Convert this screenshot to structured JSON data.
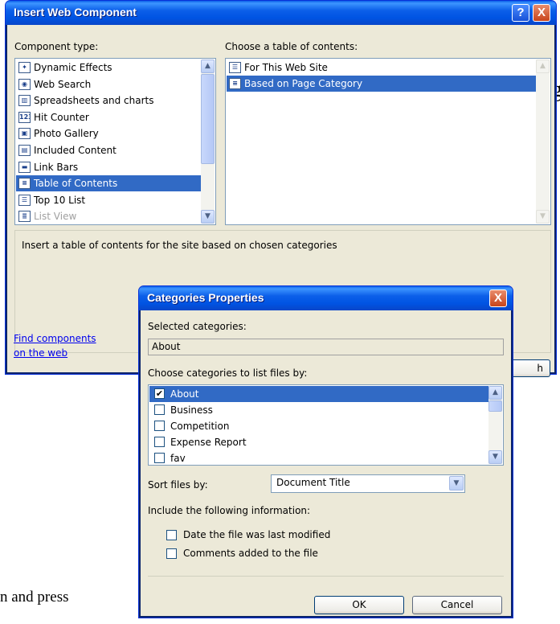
{
  "background": {
    "fragment_g": "g",
    "fragment_press": "n and press"
  },
  "insert_dialog": {
    "title": "Insert Web Component",
    "help_glyph": "?",
    "close_glyph": "X",
    "component_type_label": "Component type:",
    "component_types": [
      {
        "label": "Dynamic Effects",
        "icon": "dynamic-effects-icon",
        "selected": false,
        "disabled": false
      },
      {
        "label": "Web Search",
        "icon": "web-search-icon",
        "selected": false,
        "disabled": false
      },
      {
        "label": "Spreadsheets and charts",
        "icon": "spreadsheets-icon",
        "selected": false,
        "disabled": false
      },
      {
        "label": "Hit Counter",
        "icon": "hit-counter-icon",
        "selected": false,
        "disabled": false
      },
      {
        "label": "Photo Gallery",
        "icon": "photo-gallery-icon",
        "selected": false,
        "disabled": false
      },
      {
        "label": "Included Content",
        "icon": "included-content-icon",
        "selected": false,
        "disabled": false
      },
      {
        "label": "Link Bars",
        "icon": "link-bars-icon",
        "selected": false,
        "disabled": false
      },
      {
        "label": "Table of Contents",
        "icon": "table-of-contents-icon",
        "selected": true,
        "disabled": false
      },
      {
        "label": "Top 10 List",
        "icon": "top-10-list-icon",
        "selected": false,
        "disabled": false
      },
      {
        "label": "List View",
        "icon": "list-view-icon",
        "selected": false,
        "disabled": true
      }
    ],
    "toc_label": "Choose a table of contents:",
    "toc_options": [
      {
        "label": "For This Web Site",
        "icon": "toc-site-icon",
        "selected": false
      },
      {
        "label": "Based on Page Category",
        "icon": "toc-category-icon",
        "selected": true
      }
    ],
    "description": "Insert a table of contents for the site based on chosen categories",
    "find_link_line1": "Find components",
    "find_link_line2": "on the web",
    "partial_button_text": "h"
  },
  "categories_dialog": {
    "title": "Categories Properties",
    "close_glyph": "X",
    "selected_label": "Selected categories:",
    "selected_value": "About",
    "list_label": "Choose categories to list files by:",
    "categories": [
      {
        "label": "About",
        "checked": true,
        "selected": true
      },
      {
        "label": "Business",
        "checked": false,
        "selected": false
      },
      {
        "label": "Competition",
        "checked": false,
        "selected": false
      },
      {
        "label": "Expense Report",
        "checked": false,
        "selected": false
      },
      {
        "label": "fav",
        "checked": false,
        "selected": false
      }
    ],
    "sort_label": "Sort files by:",
    "sort_value": "Document Title",
    "include_label": "Include the following information:",
    "option_date": "Date the file was last modified",
    "option_date_checked": false,
    "option_comments": "Comments added to the file",
    "option_comments_checked": false,
    "ok_label": "OK",
    "cancel_label": "Cancel"
  },
  "colors": {
    "titlebar_blue": "#0054e3",
    "selection_blue": "#316ac5",
    "dialog_face": "#ece9d8",
    "close_red": "#c8441b"
  }
}
